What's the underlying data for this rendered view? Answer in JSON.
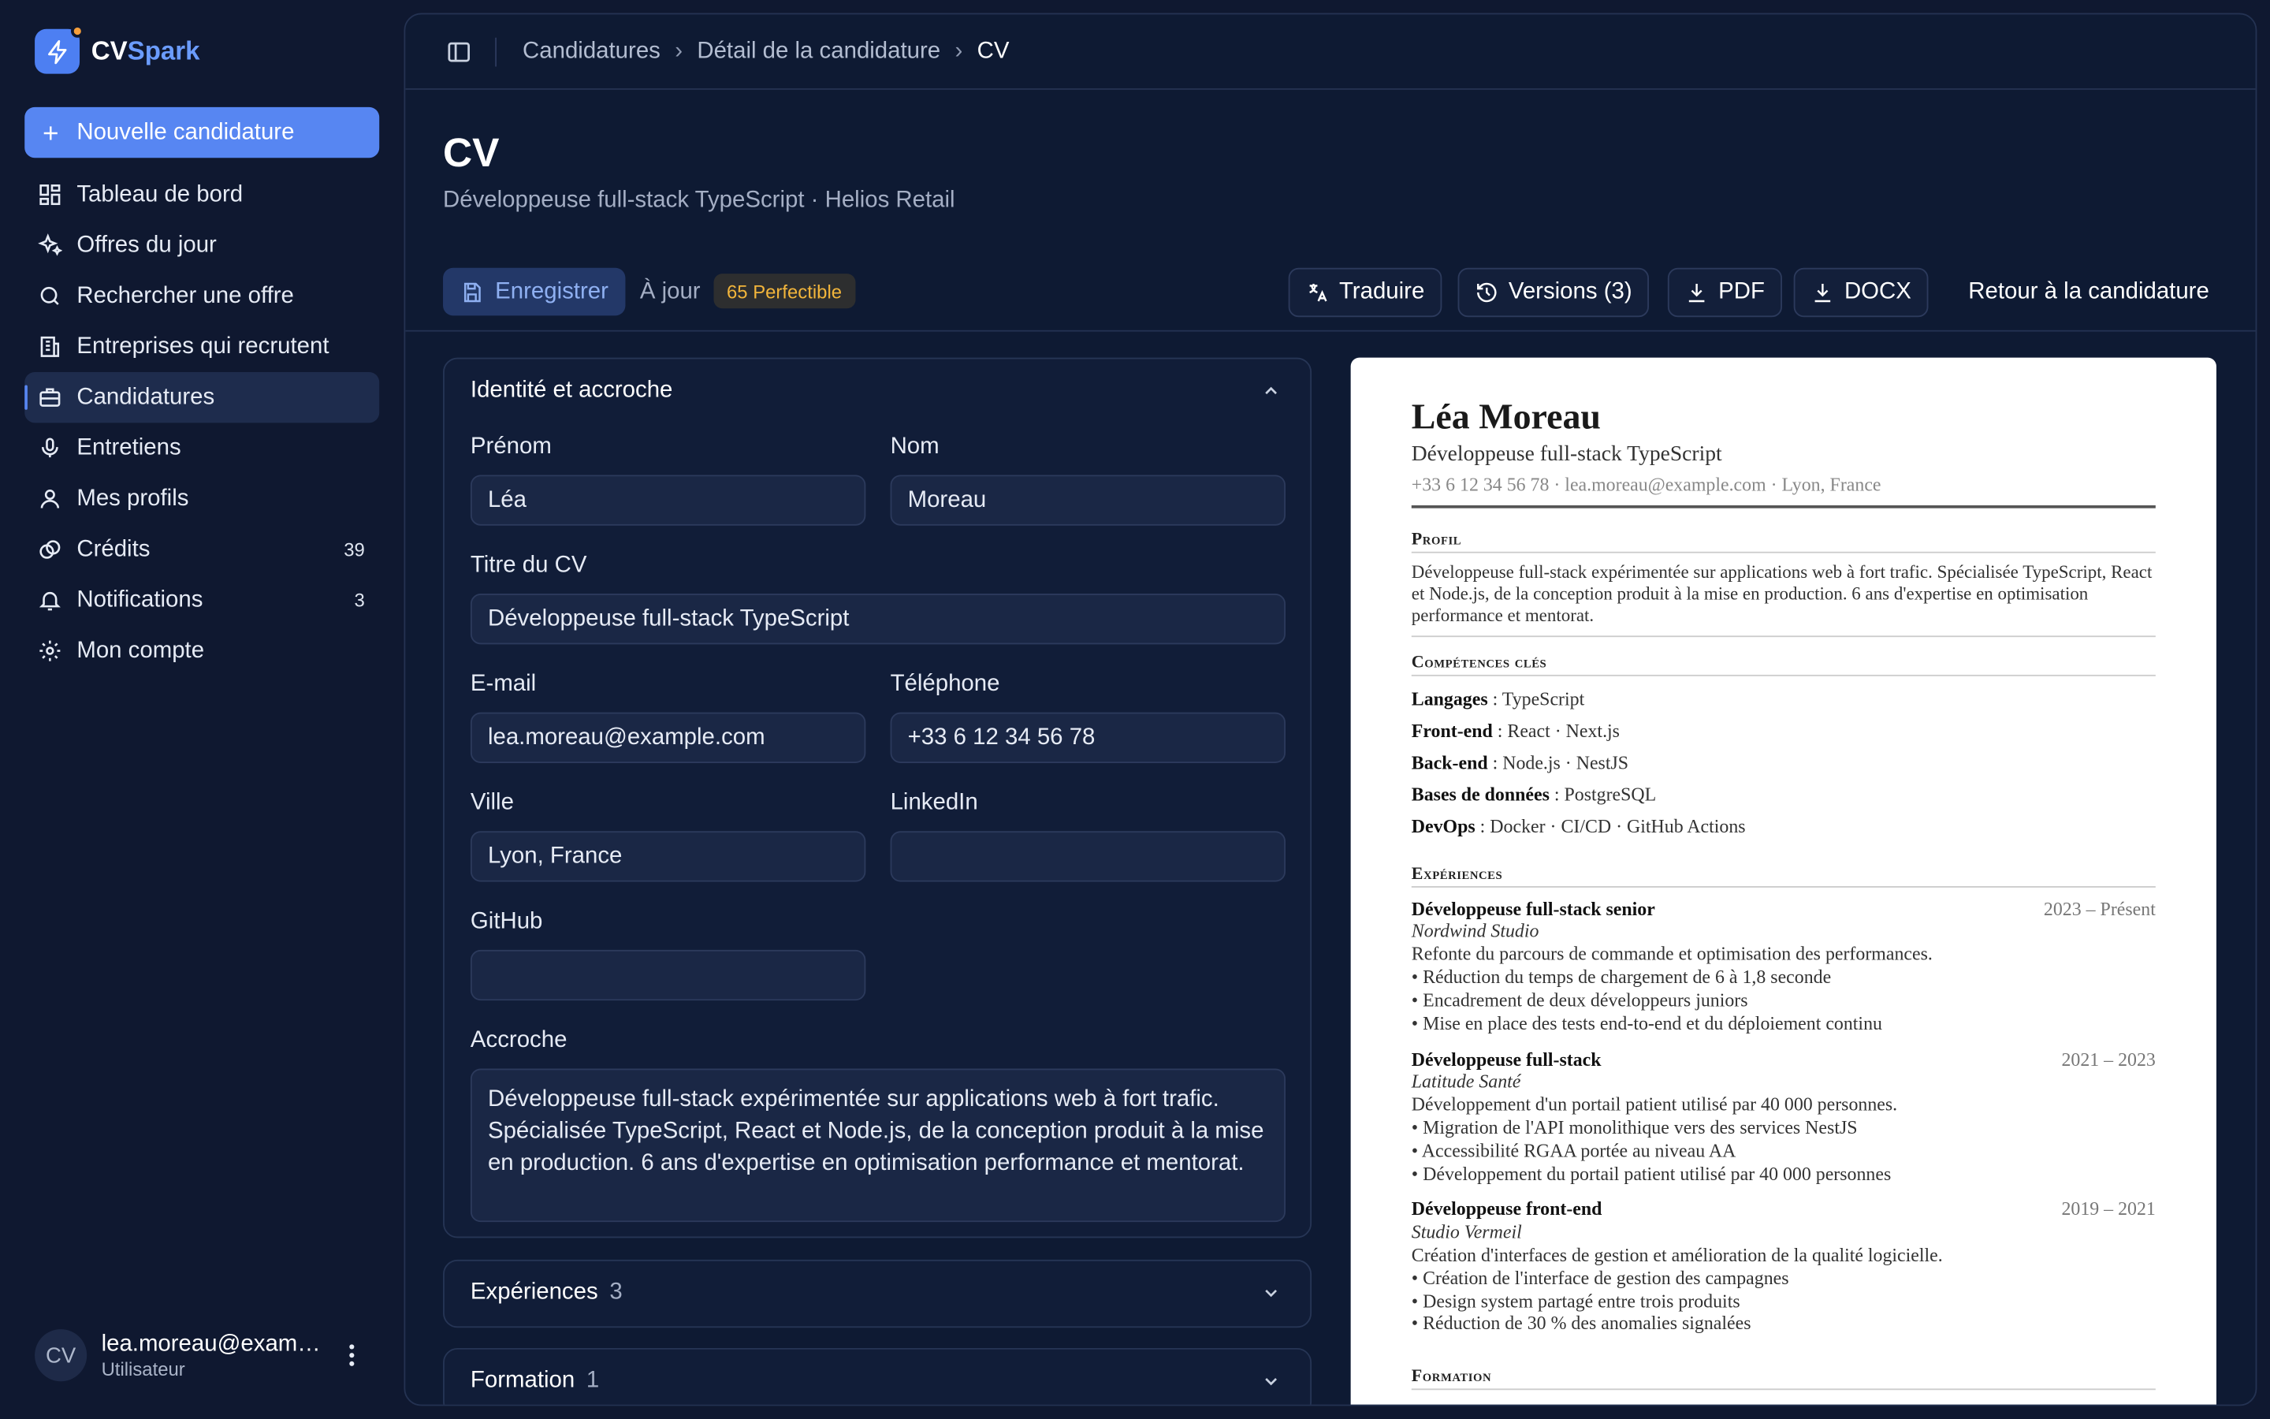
{
  "app": {
    "name_a": "CV",
    "name_b": "Spark"
  },
  "sidebar": {
    "new_label": "Nouvelle candidature",
    "items": [
      {
        "label": "Tableau de bord",
        "icon": "dashboard-icon"
      },
      {
        "label": "Offres du jour",
        "icon": "sparkles-icon"
      },
      {
        "label": "Rechercher une offre",
        "icon": "search-icon"
      },
      {
        "label": "Entreprises qui recrutent",
        "icon": "building-icon"
      },
      {
        "label": "Candidatures",
        "icon": "briefcase-icon",
        "active": true
      },
      {
        "label": "Entretiens",
        "icon": "microphone-icon"
      },
      {
        "label": "Mes profils",
        "icon": "user-icon"
      },
      {
        "label": "Crédits",
        "icon": "coins-icon",
        "count": "39"
      },
      {
        "label": "Notifications",
        "icon": "bell-icon",
        "count": "3"
      },
      {
        "label": "Mon compte",
        "icon": "gear-icon"
      }
    ]
  },
  "user": {
    "initials": "CV",
    "email": "lea.moreau@example.com",
    "role": "Utilisateur"
  },
  "breadcrumb": [
    "Candidatures",
    "Détail de la candidature",
    "CV"
  ],
  "page": {
    "title": "CV",
    "subtitle": "Développeuse full-stack TypeScript · Helios Retail"
  },
  "toolbar": {
    "save": "Enregistrer",
    "status": "À jour",
    "score": "65 Perfectible",
    "translate": "Traduire",
    "versions": "Versions (3)",
    "pdf": "PDF",
    "docx": "DOCX",
    "back": "Retour à la candidature"
  },
  "identity": {
    "heading": "Identité et accroche",
    "first_name_label": "Prénom",
    "first_name": "Léa",
    "last_name_label": "Nom",
    "last_name": "Moreau",
    "cv_title_label": "Titre du CV",
    "cv_title": "Développeuse full-stack TypeScript",
    "email_label": "E-mail",
    "email": "lea.moreau@example.com",
    "phone_label": "Téléphone",
    "phone": "+33 6 12 34 56 78",
    "city_label": "Ville",
    "city": "Lyon, France",
    "linkedin_label": "LinkedIn",
    "linkedin": "",
    "github_label": "GitHub",
    "github": "",
    "hook_label": "Accroche",
    "hook": "Développeuse full-stack expérimentée sur applications web à fort trafic. Spécialisée TypeScript, React et Node.js, de la conception produit à la mise en production. 6 ans d'expertise en optimisation performance et mentorat."
  },
  "sections": {
    "experiences": {
      "label": "Expériences",
      "count": "3"
    },
    "formation": {
      "label": "Formation",
      "count": "1"
    }
  },
  "resume": {
    "name": "Léa Moreau",
    "title": "Développeuse full-stack TypeScript",
    "contact": "+33 6 12 34 56 78 · lea.moreau@example.com · Lyon, France",
    "profile_heading": "Profil",
    "profile": "Développeuse full-stack expérimentée sur applications web à fort trafic. Spécialisée TypeScript, React et Node.js, de la conception produit à la mise en production. 6 ans d'expertise en optimisation performance et mentorat.",
    "skills_heading": "Compétences clés",
    "skills": [
      {
        "k": "Langages",
        "v": " : TypeScript"
      },
      {
        "k": "Front-end",
        "v": " : React · Next.js"
      },
      {
        "k": "Back-end",
        "v": " : Node.js · NestJS"
      },
      {
        "k": "Bases de données",
        "v": " : PostgreSQL"
      },
      {
        "k": "DevOps",
        "v": " : Docker · CI/CD · GitHub Actions"
      }
    ],
    "exp_heading": "Expériences",
    "experiences": [
      {
        "role": "Développeuse full-stack senior",
        "dates": "2023 – Présent",
        "company": "Nordwind Studio",
        "summary": "Refonte du parcours de commande et optimisation des performances.",
        "bullets": [
          "• Réduction du temps de chargement de 6 à 1,8 seconde",
          "• Encadrement de deux développeurs juniors",
          "• Mise en place des tests end-to-end et du déploiement continu"
        ]
      },
      {
        "role": "Développeuse full-stack",
        "dates": "2021 – 2023",
        "company": "Latitude Santé",
        "summary": "Développement d'un portail patient utilisé par 40 000 personnes.",
        "bullets": [
          "• Migration de l'API monolithique vers des services NestJS",
          "• Accessibilité RGAA portée au niveau AA",
          "• Développement du portail patient utilisé par 40 000 personnes"
        ]
      },
      {
        "role": "Développeuse front-end",
        "dates": "2019 – 2021",
        "company": "Studio Vermeil",
        "summary": "Création d'interfaces de gestion et amélioration de la qualité logicielle.",
        "bullets": [
          "• Création de l'interface de gestion des campagnes",
          "• Design system partagé entre trois produits",
          "• Réduction de 30 % des anomalies signalées"
        ]
      }
    ],
    "formation_heading": "Formation"
  }
}
